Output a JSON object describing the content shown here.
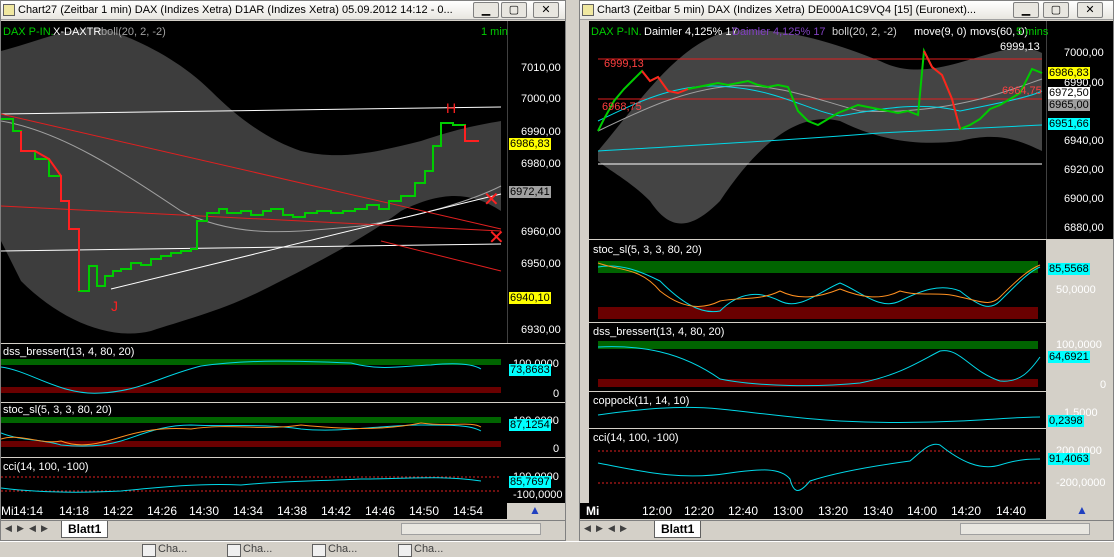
{
  "window1": {
    "title": "Chart27 (Zeitbar 1 min)  DAX (Indizes Xetra) D1AR (Indizes Xetra) 05.09.2012 14:12 - 0...",
    "header_left": "DAX P-IN.",
    "header_symbol": "X-DAXTR",
    "header_boll": "boll(20, 2, -2)",
    "header_right": "1 min",
    "price_ticks": [
      "7010,00",
      "7000,00",
      "6990,00",
      "6980,00",
      "6970,00",
      "6960,00",
      "6950,00",
      "6930,00"
    ],
    "value_boxes": [
      "6986,83",
      "6972,41",
      "6940,10"
    ],
    "ind1_label": "dss_bressert(13, 4, 80, 20)",
    "ind1_value": "73,8683",
    "ind1_tick_top": "100,0000",
    "ind1_tick_bottom": "0",
    "ind2_label": "stoc_sl(5, 3, 3, 80, 20)",
    "ind2_value": "87,1254",
    "ind2_tick_top": "100,0000",
    "ind2_tick_bottom": "0",
    "ind3_label": "cci(14, 100, -100)",
    "ind3_value": "85,7697",
    "ind3_tick_top": "100,0000",
    "ind3_tick_bottom": "-100,0000",
    "x_labels": [
      "Mi",
      "14:14",
      "14:18",
      "14:22",
      "14:26",
      "14:30",
      "14:34",
      "14:38",
      "14:42",
      "14:46",
      "14:50",
      "14:54"
    ],
    "tab": "Blatt1"
  },
  "window2": {
    "title": "Chart3 (Zeitbar 5 min)  DAX (Indizes Xetra) DE000A1C9VQ4 [15] (Euronext)...",
    "header_left": "DAX P-IN.",
    "header_daimler1": "Daimler  4,125% 17",
    "header_daimler2": "Daimler  4,125% 17",
    "header_boll": "boll(20, 2, -2)",
    "header_move": "move(9, 0)",
    "header_movs": "movs(60, 0)",
    "header_right": "5 mins",
    "top_value": "6999,13",
    "price_ticks": [
      "7000,00",
      "6990,00",
      "6960,00",
      "6940,00",
      "6920,00",
      "6900,00",
      "6880,00"
    ],
    "value_boxes": [
      "6986,83",
      "6972,50",
      "6965,00",
      "6951,66"
    ],
    "annotations": [
      "6999,13",
      "6968,75",
      "6964,75"
    ],
    "ind1_label": "stoc_sl(5, 3, 3, 80, 20)",
    "ind1_value": "85,5568",
    "ind1_tick_mid": "50,0000",
    "ind2_label": "dss_bressert(13, 4, 80, 20)",
    "ind2_value": "64,6921",
    "ind2_tick_top": "100,0000",
    "ind2_tick_bottom": "0",
    "ind3_label": "coppock(11, 14, 10)",
    "ind3_value": "0,2398",
    "ind3_tick_top": "1,5000",
    "ind4_label": "cci(14, 100, -100)",
    "ind4_value": "91,4063",
    "ind4_tick_top": "200,0000",
    "ind4_tick_bottom": "-200,0000",
    "x_labels": [
      "Mi",
      "12:00",
      "12:20",
      "12:40",
      "13:00",
      "13:20",
      "13:40",
      "14:00",
      "14:20",
      "14:40"
    ],
    "tab": "Blatt1"
  },
  "taskbar": {
    "items": [
      "Cha...",
      "Cha...",
      "Cha...",
      "Cha..."
    ]
  },
  "colors": {
    "up": "#00cc00",
    "down": "#ff2020",
    "band": "#808080",
    "cyan": "#00d8e8",
    "yellowbox": "#ffff00",
    "cyanbox": "#00ffff",
    "green_zone": "#007000",
    "red_zone": "#700000"
  }
}
